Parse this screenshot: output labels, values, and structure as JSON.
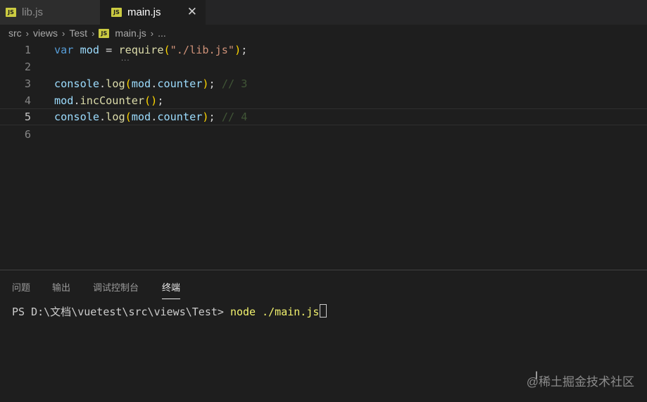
{
  "tabs": [
    {
      "icon": "JS",
      "label": "lib.js",
      "active": false
    },
    {
      "icon": "JS",
      "label": "main.js",
      "active": true,
      "close": "✕"
    }
  ],
  "breadcrumb": {
    "segments": [
      "src",
      "views",
      "Test"
    ],
    "file": "main.js",
    "ellipsis": "..."
  },
  "editor": {
    "lines": [
      {
        "number": "1",
        "code": "var mod = require(\"./lib.js\");"
      },
      {
        "number": "2",
        "code": ""
      },
      {
        "number": "3",
        "code": "console.log(mod.counter); // 3"
      },
      {
        "number": "4",
        "code": "mod.incCounter();"
      },
      {
        "number": "5",
        "code": "console.log(mod.counter); // 4"
      },
      {
        "number": "6",
        "code": ""
      }
    ],
    "current_line": 5,
    "hint_dots": "..."
  },
  "panel": {
    "tabs": [
      "问题",
      "输出",
      "调试控制台",
      "终端"
    ],
    "active_tab": "终端",
    "terminal": {
      "prompt": "PS D:\\文档\\vuetest\\src\\views\\Test> ",
      "command": "node ./main.js"
    }
  },
  "watermark": "@稀土掘金技术社区",
  "colors": {
    "background": "#1e1e1e",
    "keyword": "#569cd6",
    "variable": "#9cdcfe",
    "function": "#dcdcaa",
    "string": "#ce9178",
    "bracket": "#ffd700",
    "js_icon": "#cbcb41"
  }
}
